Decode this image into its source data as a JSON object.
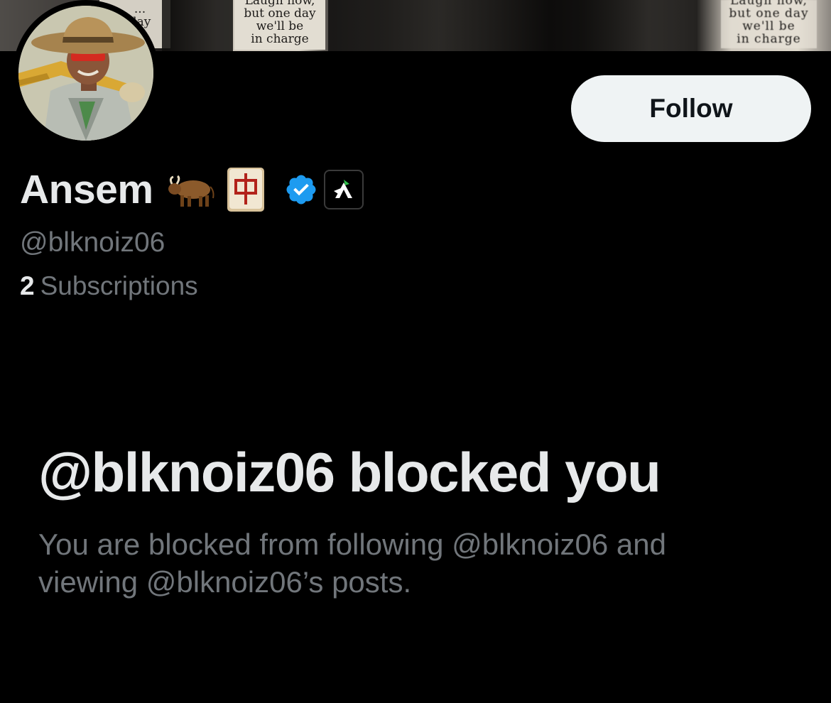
{
  "banner": {
    "poster_main": [
      "Laugh now,",
      "but one day",
      "we'll be",
      "in charge"
    ],
    "poster_left": [
      "...",
      "day"
    ],
    "poster_right": [
      "Laugh now,",
      "but one day",
      "we'll be",
      "in charge"
    ]
  },
  "profile": {
    "display_name": "Ansem",
    "handle": "@blknoiz06",
    "subscriptions_count": "2",
    "subscriptions_label": "Subscriptions",
    "name_badges": [
      "ox-emoji",
      "mahjong-red-dragon-emoji",
      "verified-badge",
      "affiliate-badge"
    ]
  },
  "actions": {
    "follow_label": "Follow"
  },
  "blocked": {
    "title": "@blknoiz06 blocked you",
    "description": "You are blocked from following @blknoiz06 and viewing @blknoiz06’s posts."
  },
  "colors": {
    "background": "#000000",
    "primary_text": "#e7e9ea",
    "secondary_text": "#71767b",
    "button_bg": "#eff3f4",
    "verified_blue": "#1d9bf0"
  }
}
